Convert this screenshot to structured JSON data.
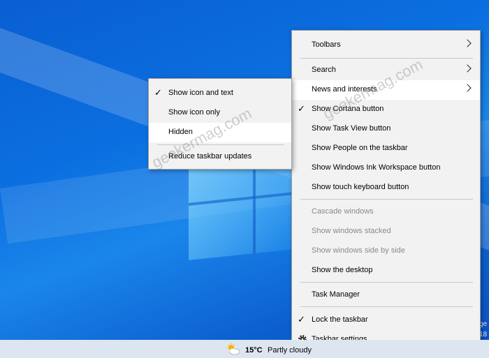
{
  "context_menu": {
    "items": [
      {
        "label": "Toolbars",
        "arrow": true
      },
      {
        "label": "Search",
        "arrow": true
      },
      {
        "label": "News and interests",
        "arrow": true,
        "highlighted": true
      },
      {
        "label": "Show Cortana button",
        "checked": true
      },
      {
        "label": "Show Task View button"
      },
      {
        "label": "Show People on the taskbar"
      },
      {
        "label": "Show Windows Ink Workspace button"
      },
      {
        "label": "Show touch keyboard button"
      },
      {
        "label": "Cascade windows",
        "disabled": true
      },
      {
        "label": "Show windows stacked",
        "disabled": true
      },
      {
        "label": "Show windows side by side",
        "disabled": true
      },
      {
        "label": "Show the desktop"
      },
      {
        "label": "Task Manager"
      },
      {
        "label": "Lock the taskbar",
        "checked": true
      },
      {
        "label": "Taskbar settings",
        "icon": "gear-icon"
      }
    ]
  },
  "submenu": {
    "items": [
      {
        "label": "Show icon and text",
        "checked": true
      },
      {
        "label": "Show icon only"
      },
      {
        "label": "Hidden",
        "highlighted": true
      },
      {
        "label": "Reduce taskbar updates"
      }
    ]
  },
  "taskbar": {
    "weather_icon": "partly-cloudy-icon",
    "temperature": "15°C",
    "condition": "Partly cloudy"
  },
  "watermark": "geekermag.com",
  "edge_text": [
    "ge",
    "18"
  ],
  "colors": {
    "menu_bg": "#f2f2f2",
    "highlight": "#ffffff",
    "disabled_text": "#8a8a8a",
    "desktop": "#0b6fe0"
  }
}
